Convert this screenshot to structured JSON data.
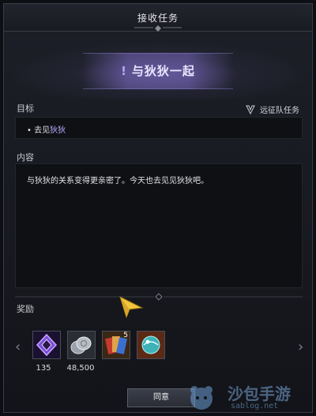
{
  "dialog": {
    "title": "接收任务",
    "quest_title": "与狄狄一起",
    "quest_icon": "exclamation-icon",
    "accent_color": "#b8a8ff"
  },
  "goal": {
    "label": "目标",
    "expedition_label": "远征队任务",
    "bullet": "•",
    "prefix": "去见",
    "highlight": "狄狄"
  },
  "content": {
    "label": "内容",
    "text": "与狄狄的关系变得更亲密了。今天也去见见狄狄吧。"
  },
  "rewards": {
    "label": "奖励",
    "items": [
      {
        "icon": "purple-crystal-icon",
        "count": "135"
      },
      {
        "icon": "silver-coins-icon",
        "count": "48,500"
      },
      {
        "icon": "cards-icon",
        "badge": "5"
      },
      {
        "icon": "orb-icon"
      }
    ]
  },
  "buttons": {
    "agree": "同意"
  },
  "watermark": {
    "name": "沙包手游",
    "url": "sablog.net"
  }
}
